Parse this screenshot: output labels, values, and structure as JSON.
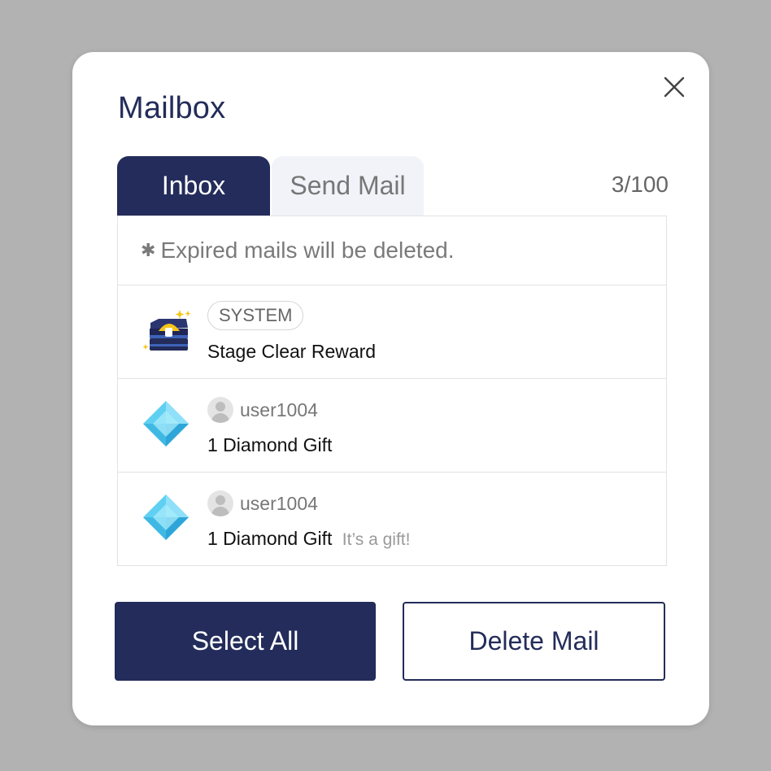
{
  "dialog": {
    "title": "Mailbox",
    "close_icon": "close-icon"
  },
  "tabs": [
    {
      "label": "Inbox",
      "active": true
    },
    {
      "label": "Send Mail",
      "active": false
    }
  ],
  "mail_count": "3/100",
  "notice": {
    "icon": "asterisk-icon",
    "text": "Expired mails will be deleted."
  },
  "mails": [
    {
      "icon": "treasure-chest-icon",
      "tag": "SYSTEM",
      "subject": "Stage Clear Reward",
      "note": ""
    },
    {
      "icon": "diamond-icon",
      "sender": "user1004",
      "subject": "1 Diamond Gift",
      "note": ""
    },
    {
      "icon": "diamond-icon",
      "sender": "user1004",
      "subject": "1 Diamond Gift",
      "note": "It’s a gift!"
    }
  ],
  "buttons": {
    "select_all": "Select All",
    "delete_mail": "Delete Mail"
  },
  "colors": {
    "primary": "#232c5a",
    "overlay": "#b2b2b2",
    "tab_inactive": "#f1f3f9",
    "diamond": "#5fd0f2",
    "chest_gold": "#f5c518"
  }
}
